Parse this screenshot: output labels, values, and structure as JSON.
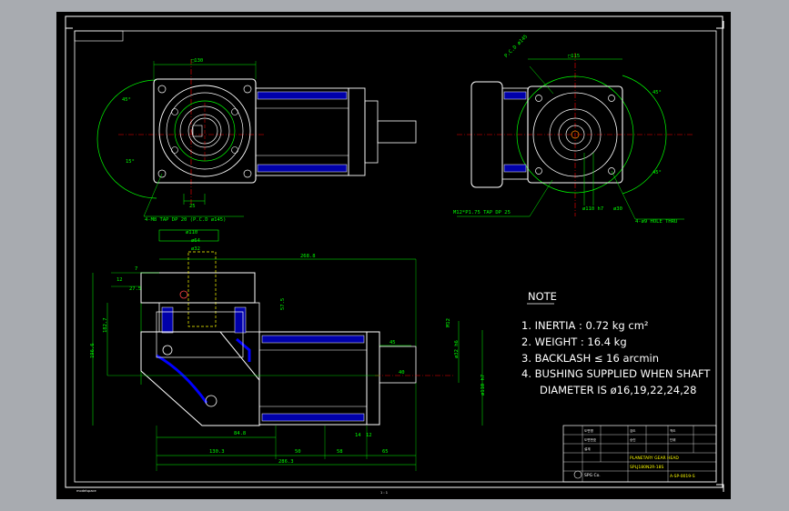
{
  "note": {
    "title": "NOTE",
    "items": [
      "1. INERTIA : 0.72 kg cm²",
      "2. WEIGHT : 16.4 kg",
      "3. BACKLASH ≤ 16 arcmin",
      "4. BUSHING SUPPLIED WHEN SHAFT",
      "DIAMETER IS ø16,19,22,24,28"
    ]
  },
  "dimensions": {
    "front_square": "□130",
    "front_45_left": "45°",
    "front_15": "15°",
    "front_25": "25",
    "front_tap": "4-M8 TAP DP 20 (P.C.D ø145)",
    "side_pcd": "P.C.D ø145",
    "side_square": "□115",
    "side_45": "45°",
    "side_45b": "45°",
    "side_tap": "M12*P1.75 TAP DP 25",
    "side_hole": "4-ø9 HOLE THRU",
    "side_j6": "ø110 h7",
    "side_shaft": "ø30",
    "top_d1": "ø110",
    "top_d2": "ø64",
    "top_d3": "ø32",
    "top_268": "268.8",
    "top_7": "7",
    "top_12": "12",
    "top_27": "27.5",
    "top_182": "182.7",
    "top_196": "196.6",
    "top_57": "57.5",
    "top_45": "45",
    "top_84": "84.8",
    "top_130": "130.3",
    "top_50": "50",
    "top_58": "58",
    "top_14": "14",
    "top_12b": "12",
    "top_23": "23",
    "top_65": "65",
    "top_286": "286.3",
    "top_h7": "ø110 h7",
    "top_j6": "ø32 h6",
    "top_m12": "M12",
    "top_40": "40"
  },
  "title_block": {
    "company": "SPG Co.",
    "product": "PLANETARY GEAR HEAD",
    "model": "SPLJ180N2R-18S",
    "drawing_no": "A-SP-0019-S",
    "labels": [
      "도면명",
      "도면번호",
      "설계",
      "검도",
      "승인",
      "척도",
      "단위"
    ]
  },
  "status_bar": {
    "left": "modelspace",
    "center": "1 : 1"
  }
}
